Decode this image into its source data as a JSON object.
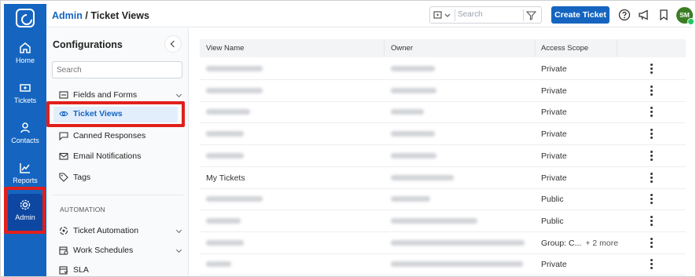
{
  "app": {
    "breadcrumb_root": "Admin",
    "breadcrumb_sep": "/",
    "page_title": "Ticket Views"
  },
  "rail": {
    "items": [
      {
        "label": "Home",
        "icon": "home-icon"
      },
      {
        "label": "Tickets",
        "icon": "ticket-icon"
      },
      {
        "label": "Contacts",
        "icon": "person-icon"
      },
      {
        "label": "Reports",
        "icon": "chart-icon"
      },
      {
        "label": "Admin",
        "icon": "gear-icon",
        "active": true
      }
    ]
  },
  "topbar": {
    "search_placeholder": "Search",
    "create_label": "Create Ticket",
    "avatar_initials": "SM",
    "icons": [
      "help-icon",
      "megaphone-icon",
      "bookmark-icon"
    ]
  },
  "config": {
    "title": "Configurations",
    "search_placeholder": "Search",
    "items": [
      {
        "label": "Fields and Forms",
        "icon": "form-icon",
        "expandable": true
      },
      {
        "label": "Ticket Views",
        "icon": "eye-icon",
        "active": true
      },
      {
        "label": "Canned Responses",
        "icon": "chat-icon"
      },
      {
        "label": "Email Notifications",
        "icon": "mail-icon"
      },
      {
        "label": "Tags",
        "icon": "tag-icon"
      }
    ],
    "section": "AUTOMATION",
    "automation_items": [
      {
        "label": "Ticket Automation",
        "icon": "automation-icon",
        "expandable": true
      },
      {
        "label": "Work Schedules",
        "icon": "schedule-icon",
        "expandable": true
      },
      {
        "label": "SLA",
        "icon": "sla-icon"
      }
    ]
  },
  "table": {
    "columns": [
      "View Name",
      "Owner",
      "Access Scope"
    ],
    "rows": [
      {
        "name": "",
        "owner": "",
        "scope": "Private"
      },
      {
        "name": "",
        "owner": "",
        "scope": "Private"
      },
      {
        "name": "",
        "owner": "",
        "scope": "Private"
      },
      {
        "name": "",
        "owner": "",
        "scope": "Private"
      },
      {
        "name": "",
        "owner": "",
        "scope": "Private"
      },
      {
        "name": "My Tickets",
        "owner": "",
        "scope": "Private"
      },
      {
        "name": "",
        "owner": "",
        "scope": "Public"
      },
      {
        "name": "",
        "owner": "",
        "scope": "Public"
      },
      {
        "name": "",
        "owner": "",
        "scope": "Group: C...",
        "extra": "+ 2 more"
      },
      {
        "name": "",
        "owner": "",
        "scope": "Private"
      }
    ]
  },
  "colors": {
    "brand": "#1565c0",
    "highlight": "#e0201c",
    "avatar": "#3b7d23"
  }
}
